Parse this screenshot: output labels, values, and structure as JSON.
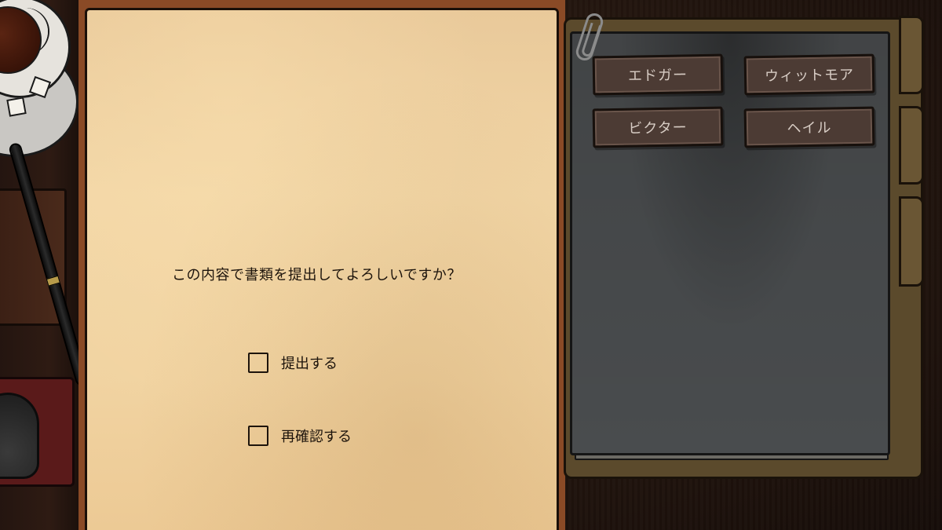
{
  "dialog": {
    "question": "この内容で書類を提出してよろしいですか？",
    "options": [
      {
        "label": "提出する"
      },
      {
        "label": "再確認する"
      }
    ]
  },
  "folder": {
    "tabs": [
      {
        "label": "エドガー"
      },
      {
        "label": "ウィットモア"
      },
      {
        "label": "ビクター"
      },
      {
        "label": "ヘイル"
      }
    ]
  },
  "colors": {
    "paper": "#f1d3a1",
    "ink": "#1d140c",
    "folder_inner": "#4d5052",
    "tab_bg": "#4c3b34"
  }
}
